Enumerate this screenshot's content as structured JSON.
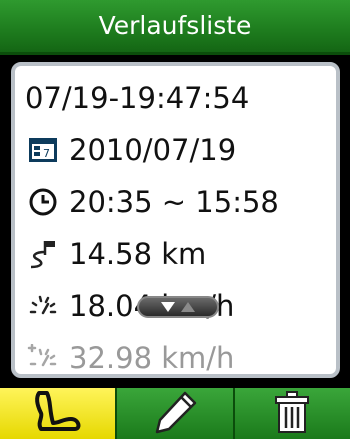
{
  "header": {
    "title": "Verlaufsliste"
  },
  "details": {
    "name": "07/19-19:47:54",
    "date": "2010/07/19",
    "time_range": "20:35 ~ 15:58",
    "distance": "14.58 km",
    "avg_speed": "18.04 km/h",
    "max_speed": "32.98 km/h"
  },
  "icons": {
    "date": "calendar-icon",
    "time": "clock-icon",
    "distance": "route-flag-icon",
    "avg_speed": "speedometer-icon",
    "max_speed": "max-speed-icon",
    "scroll": "scroll-arrows-icon"
  },
  "toolbar": {
    "items": [
      {
        "icon": "route-icon",
        "active": true
      },
      {
        "icon": "pencil-icon",
        "active": false
      },
      {
        "icon": "trash-icon",
        "active": false
      }
    ]
  },
  "colors": {
    "header": "#1f7e1f",
    "active_tool": "#f2e300",
    "panel_border": "#b9c0c7"
  }
}
